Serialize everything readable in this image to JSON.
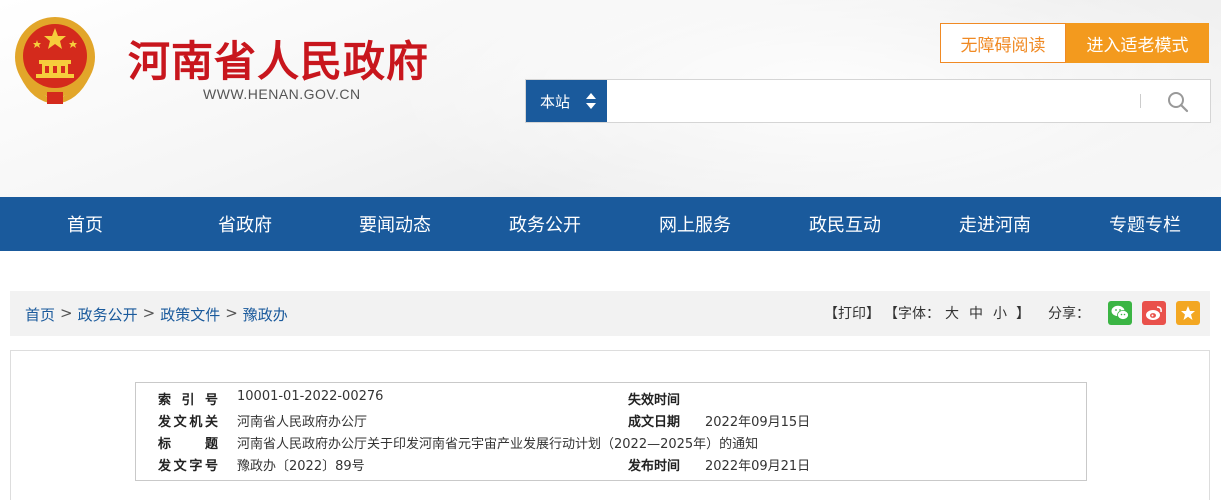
{
  "header": {
    "site_name": "河南省人民政府",
    "site_url": "WWW.HENAN.GOV.CN",
    "accessibility_button": "无障碍阅读",
    "elder_mode_button": "进入适老模式"
  },
  "search": {
    "scope_label": "本站",
    "placeholder": "",
    "value": ""
  },
  "nav": {
    "items": [
      "首页",
      "省政府",
      "要闻动态",
      "政务公开",
      "网上服务",
      "政民互动",
      "走进河南",
      "专题专栏"
    ]
  },
  "breadcrumb": {
    "items": [
      "首页",
      "政务公开",
      "政策文件",
      "豫政办"
    ],
    "separator": ">"
  },
  "tools": {
    "print": "【打印】",
    "font_prefix": "【字体：",
    "font_large": "大",
    "font_medium": "中",
    "font_small": "小",
    "font_suffix": "】",
    "share_label": "分享："
  },
  "meta": {
    "index_label": "索 引 号",
    "index_value": "10001-01-2022-00276",
    "expiry_label": "失效时间",
    "expiry_value": "",
    "issuer_label": "发文机关",
    "issuer_value": "河南省人民政府办公厅",
    "written_label": "成文日期",
    "written_value": "2022年09月15日",
    "title_label": "标    题",
    "title_value": "河南省人民政府办公厅关于印发河南省元宇宙产业发展行动计划（2022—2025年）的通知",
    "doc_no_label": "发文字号",
    "doc_no_value": "豫政办〔2022〕89号",
    "publish_label": "发布时间",
    "publish_value": "2022年09月21日"
  },
  "colors": {
    "brand_red": "#c8161d",
    "nav_blue": "#1a5a9c",
    "accent_orange": "#f39a1e"
  }
}
